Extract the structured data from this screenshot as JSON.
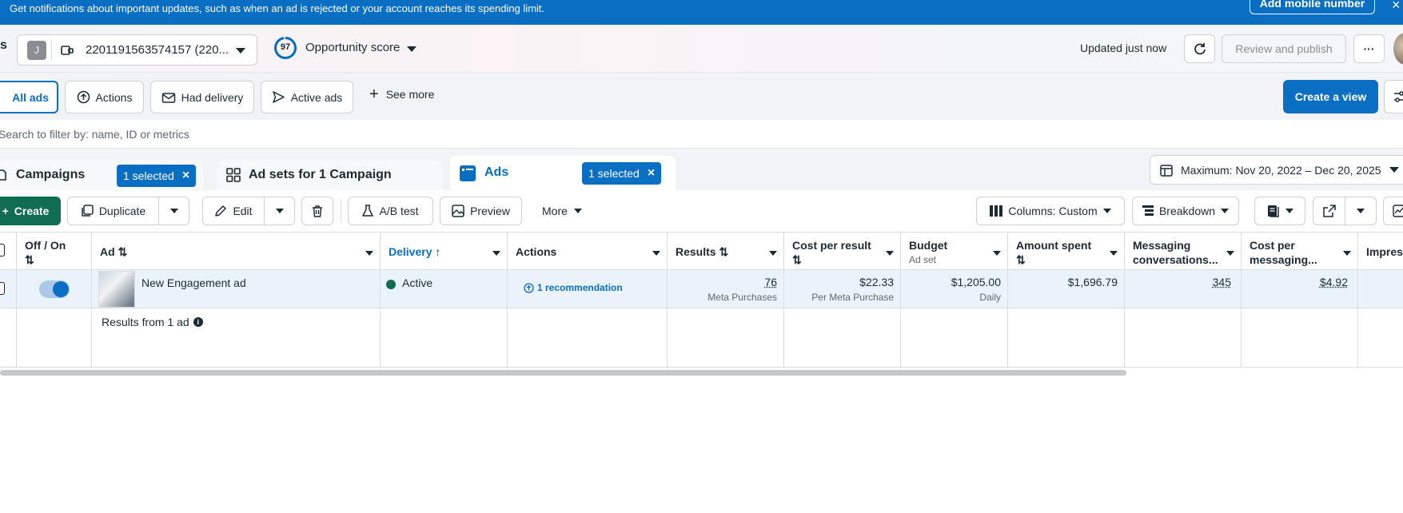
{
  "notification": {
    "message": "Get notifications about important updates, such as when an ad is rejected or your account reaches its spending limit.",
    "add_button": "Add mobile number",
    "close_icon": "×"
  },
  "topbar": {
    "left_char": "s",
    "account_initial": "J",
    "account_label": "2201191563574157 (220...",
    "opportunity_score_value": "97",
    "opportunity_score_label": "Opportunity score",
    "updated_text": "Updated just now",
    "review_publish": "Review and publish",
    "more_dots": "···"
  },
  "views": {
    "items": [
      "All ads",
      "Actions",
      "Had delivery",
      "Active ads",
      "See more"
    ],
    "create_view": "Create a view"
  },
  "search": {
    "placeholder": "Search to filter by: name, ID or metrics"
  },
  "levels": {
    "campaigns": "Campaigns",
    "campaigns_selected": "1 selected",
    "adsets": "Ad sets for 1 Campaign",
    "ads": "Ads",
    "ads_selected": "1 selected",
    "date_range": "Maximum: Nov 20, 2022 – Dec 20, 2025"
  },
  "toolbar": {
    "create": "Create",
    "duplicate": "Duplicate",
    "edit": "Edit",
    "ab_test": "A/B test",
    "preview": "Preview",
    "more": "More",
    "columns": "Columns: Custom",
    "breakdown": "Breakdown"
  },
  "table": {
    "headers": {
      "off_on": "Off / On",
      "ad": "Ad",
      "delivery": "Delivery",
      "actions": "Actions",
      "results": "Results",
      "cost_per_result": "Cost per result",
      "budget": "Budget",
      "budget_sub": "Ad set",
      "amount_spent": "Amount spent",
      "messaging_conv": "Messaging conversations...",
      "cost_per_messaging": "Cost per messaging...",
      "impressions": "Impres"
    },
    "row": {
      "ad_name": "New Engagement ad",
      "delivery": "Active",
      "recommendation": "1 recommendation",
      "results": "76",
      "results_sub": "Meta Purchases",
      "cost_per_result": "$22.33",
      "cost_per_result_sub": "Per Meta Purchase",
      "budget": "$1,205.00",
      "budget_sub": "Daily",
      "amount_spent": "$1,696.79",
      "messaging_conv": "345",
      "cost_per_messaging": "$4.92",
      "toggle_on": true
    },
    "summary": "Results from 1 ad"
  },
  "colors": {
    "brand_blue": "#0a6fc2",
    "create_green": "#106d4f",
    "active_dot": "#106d4f"
  }
}
